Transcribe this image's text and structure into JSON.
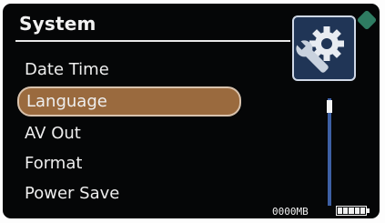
{
  "header": {
    "title": "System"
  },
  "menu": {
    "items": [
      {
        "label": "Date Time",
        "selected": false
      },
      {
        "label": "Language",
        "selected": true
      },
      {
        "label": "AV Out",
        "selected": false
      },
      {
        "label": "Format",
        "selected": false
      },
      {
        "label": "Power Save",
        "selected": false
      }
    ]
  },
  "status": {
    "storage_text": "0000MB",
    "battery_cells": 5
  },
  "icons": {
    "settings": "gear-and-wrench-icon",
    "battery": "battery-icon"
  },
  "colors": {
    "selection": "#9a6a3e",
    "scroll_track": "#3d5fa4",
    "screen_bg": "#050607"
  }
}
